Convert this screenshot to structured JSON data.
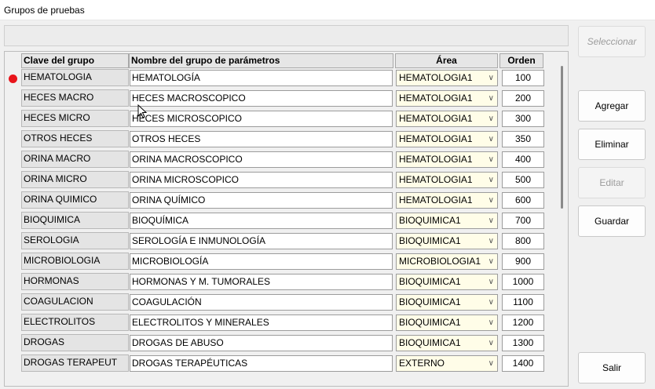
{
  "window": {
    "title": "Grupos de pruebas"
  },
  "buttons": {
    "select": "Seleccionar",
    "add": "Agregar",
    "delete": "Eliminar",
    "edit": "Editar",
    "save": "Guardar",
    "exit": "Salir"
  },
  "grid": {
    "headers": {
      "key": "Clave del grupo",
      "name": "Nombre del grupo de parámetros",
      "area": "Área",
      "order": "Orden"
    },
    "current_row_index": 0,
    "rows": [
      {
        "key": "HEMATOLOGIA",
        "name": "HEMATOLOGÍA",
        "area": "HEMATOLOGIA1",
        "order": "100"
      },
      {
        "key": "HECES MACRO",
        "name": "HECES MACROSCOPICO",
        "area": "HEMATOLOGIA1",
        "order": "200"
      },
      {
        "key": "HECES MICRO",
        "name": "HECES MICROSCOPICO",
        "area": "HEMATOLOGIA1",
        "order": "300"
      },
      {
        "key": "OTROS HECES",
        "name": "OTROS HECES",
        "area": "HEMATOLOGIA1",
        "order": "350"
      },
      {
        "key": "ORINA MACRO",
        "name": "ORINA MACROSCOPICO",
        "area": "HEMATOLOGIA1",
        "order": "400"
      },
      {
        "key": "ORINA MICRO",
        "name": "ORINA MICROSCOPICO",
        "area": "HEMATOLOGIA1",
        "order": "500"
      },
      {
        "key": "ORINA QUIMICO",
        "name": "ORINA QUÍMICO",
        "area": "HEMATOLOGIA1",
        "order": "600"
      },
      {
        "key": "BIOQUIMICA",
        "name": "BIOQUÍMICA",
        "area": "BIOQUIMICA1",
        "order": "700"
      },
      {
        "key": "SEROLOGIA",
        "name": "SEROLOGÍA  E INMUNOLOGÍA",
        "area": "BIOQUIMICA1",
        "order": "800"
      },
      {
        "key": "MICROBIOLOGIA",
        "name": "MICROBIOLOGÍA",
        "area": "MICROBIOLOGIA1",
        "order": "900"
      },
      {
        "key": "HORMONAS",
        "name": "HORMONAS Y M. TUMORALES",
        "area": "BIOQUIMICA1",
        "order": "1000"
      },
      {
        "key": "COAGULACION",
        "name": "COAGULACIÓN",
        "area": "BIOQUIMICA1",
        "order": "1100"
      },
      {
        "key": "ELECTROLITOS",
        "name": "ELECTROLITOS Y MINERALES",
        "area": "BIOQUIMICA1",
        "order": "1200"
      },
      {
        "key": "DROGAS",
        "name": "DROGAS DE ABUSO",
        "area": "BIOQUIMICA1",
        "order": "1300"
      },
      {
        "key": "DROGAS TERAPEUT",
        "name": "DROGAS TERAPÉUTICAS",
        "area": "EXTERNO",
        "order": "1400"
      }
    ]
  },
  "colors": {
    "current_row_indicator": "#e8141b",
    "area_cell_background": "#fffde8"
  }
}
